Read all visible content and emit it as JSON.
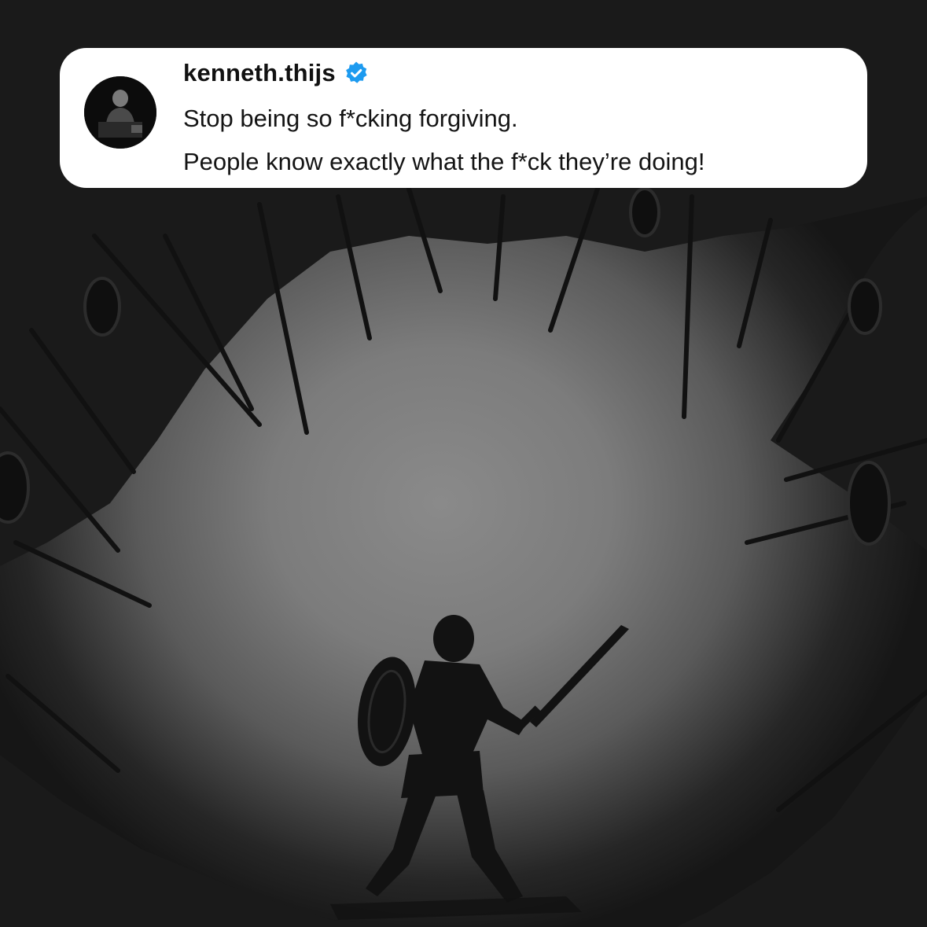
{
  "comment": {
    "username": "kenneth.thijs",
    "verified": true,
    "verified_icon": "verified-badge-icon",
    "avatar_icon": "profile-avatar",
    "lines": [
      "Stop being so f*cking forgiving.",
      "People know exactly what the f*ck they’re doing!"
    ]
  },
  "colors": {
    "verified_badge": "#1d9bf0",
    "card_background": "#ffffff",
    "text": "#111111"
  },
  "background": {
    "subject": "illustration-lone-warrior-surrounded-by-spears"
  }
}
